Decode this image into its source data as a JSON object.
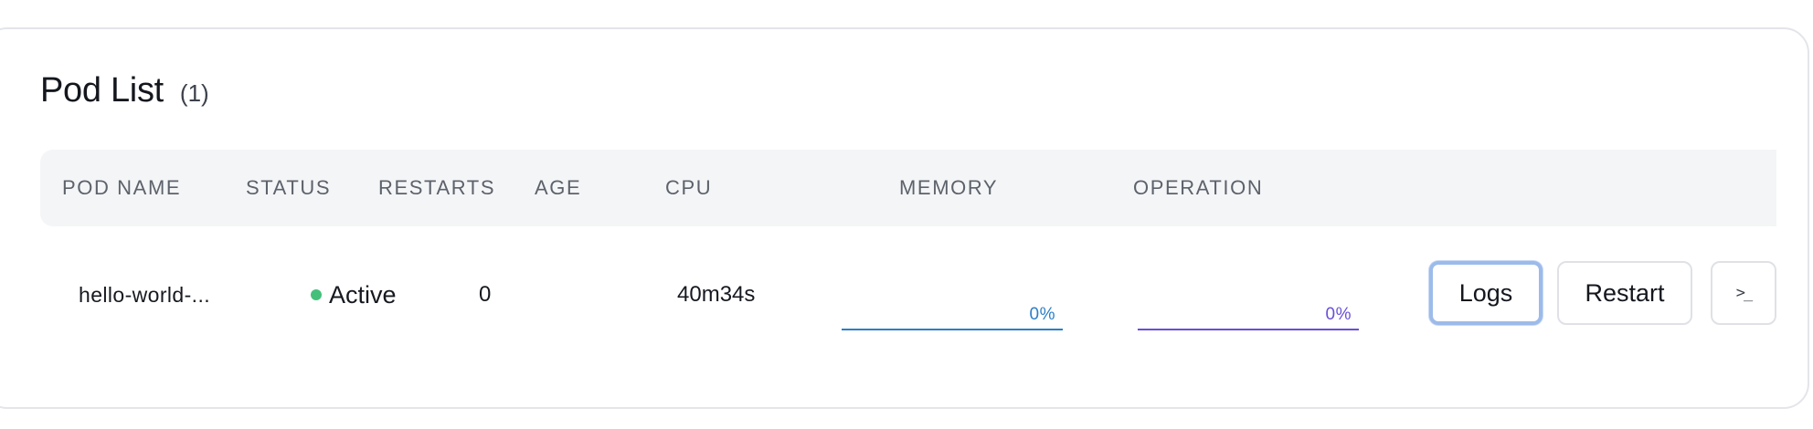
{
  "header": {
    "title": "Pod List",
    "count": "(1)"
  },
  "table": {
    "columns": [
      "POD NAME",
      "STATUS",
      "RESTARTS",
      "AGE",
      "CPU",
      "MEMORY",
      "OPERATION"
    ],
    "rows": [
      {
        "pod_name": "hello-world-...",
        "status": "Active",
        "status_color": "#45c07a",
        "restarts": "0",
        "age": "40m34s",
        "cpu": {
          "percent_label": "0%",
          "value": 0,
          "color": "#2b7fc6"
        },
        "memory": {
          "percent_label": "0%",
          "value": 0,
          "color": "#6a4fd8"
        },
        "actions": {
          "logs": "Logs",
          "restart": "Restart",
          "terminal_icon": "terminal-icon"
        }
      }
    ]
  }
}
